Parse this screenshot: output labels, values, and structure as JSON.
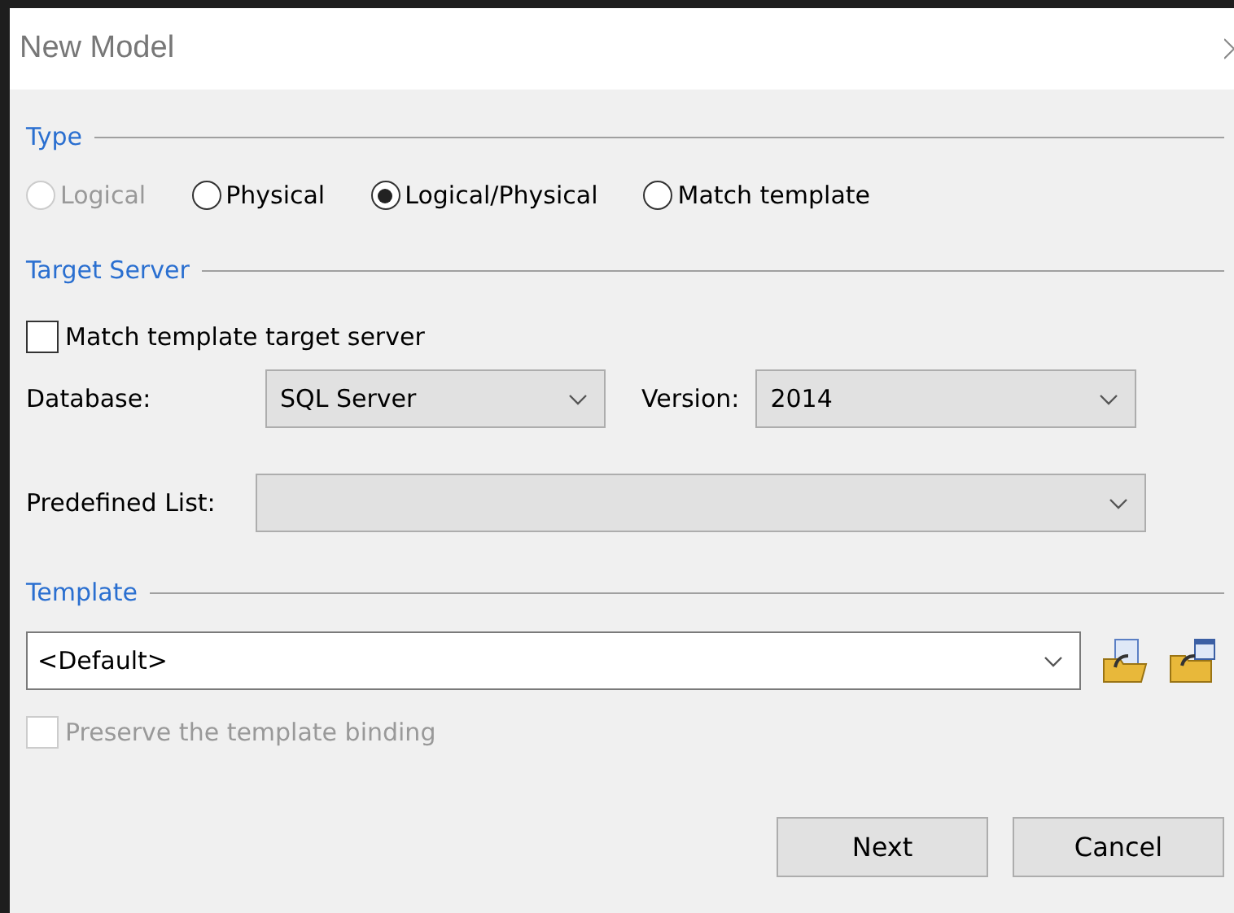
{
  "window": {
    "title": "New Model"
  },
  "type_section": {
    "title": "Type",
    "options": [
      {
        "label": "Logical",
        "selected": false,
        "disabled": true
      },
      {
        "label": "Physical",
        "selected": false,
        "disabled": false
      },
      {
        "label": "Logical/Physical",
        "selected": true,
        "disabled": false
      },
      {
        "label": "Match template",
        "selected": false,
        "disabled": false
      }
    ]
  },
  "target_server": {
    "title": "Target Server",
    "match_checkbox": {
      "label": "Match template target server",
      "checked": false,
      "disabled": false
    },
    "database": {
      "label": "Database:",
      "value": "SQL Server"
    },
    "version": {
      "label": "Version:",
      "value": "2014"
    },
    "predefined_list": {
      "label": "Predefined List:"
    }
  },
  "template": {
    "title": "Template",
    "value": "<Default>",
    "preserve_checkbox": {
      "label": "Preserve the template binding",
      "checked": false,
      "disabled": true
    }
  },
  "buttons": [
    "Next",
    "Cancel"
  ]
}
